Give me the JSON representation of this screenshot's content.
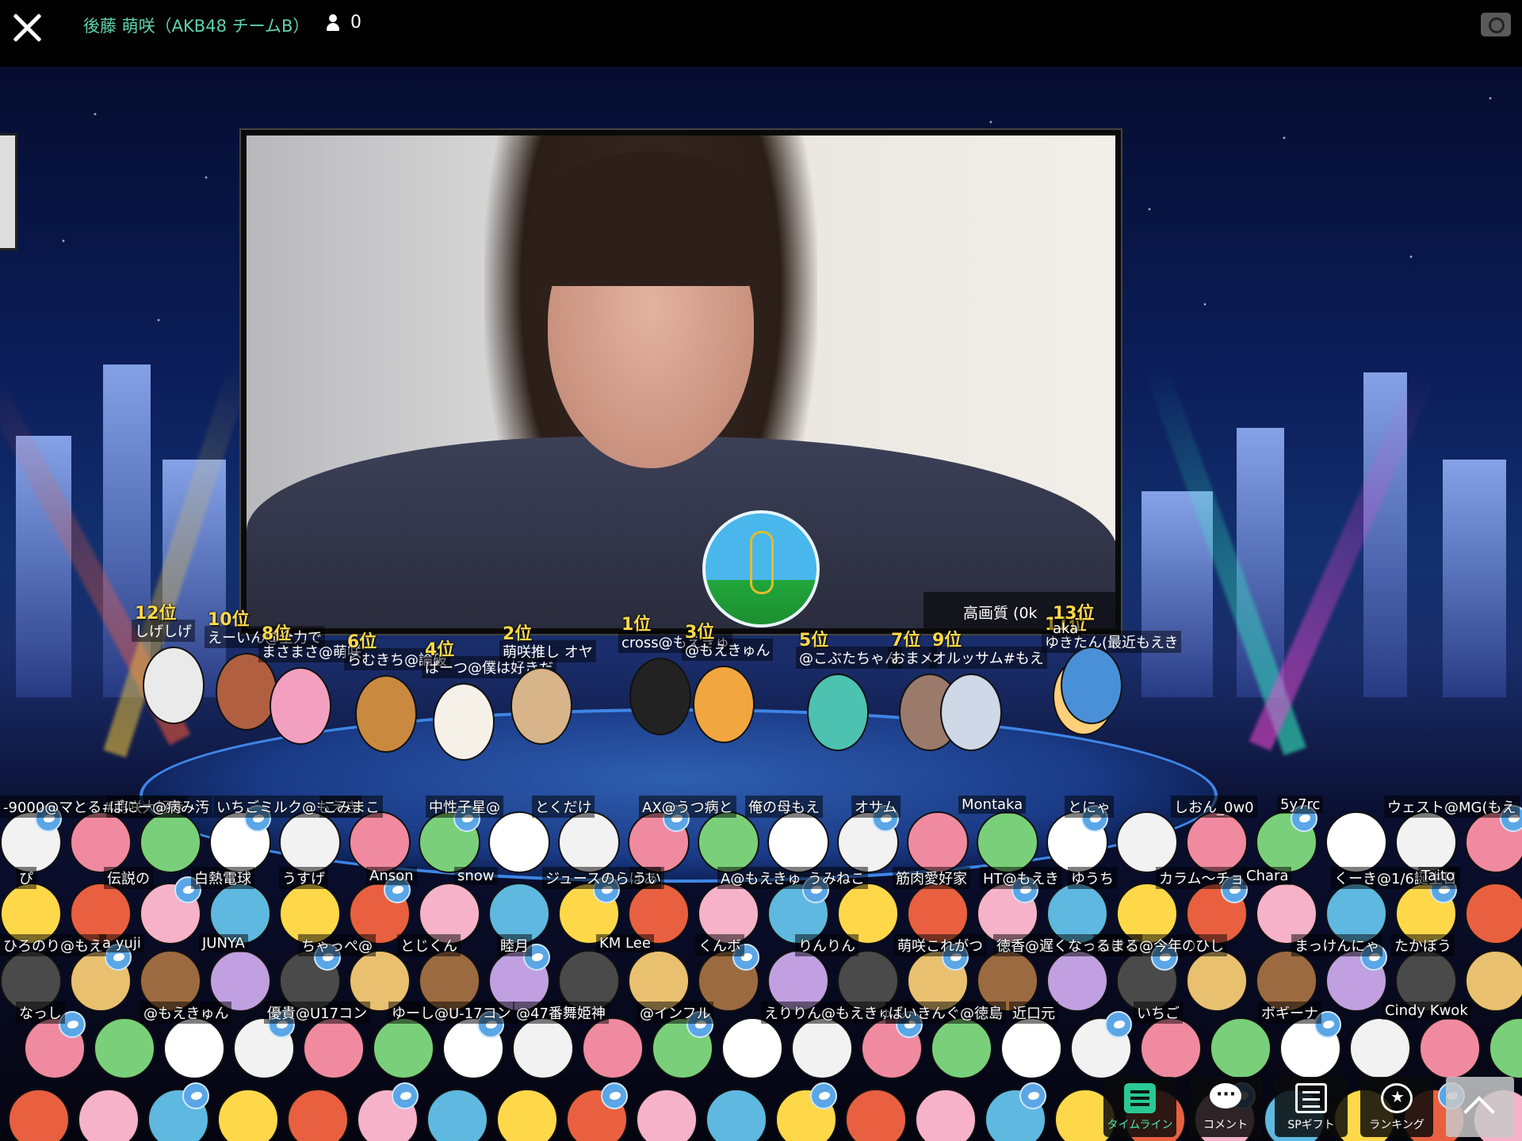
{
  "header": {
    "streamer_name": "後藤 萌咲（AKB48 チームB）",
    "viewer_count": "0"
  },
  "video": {
    "quality_label": "高画質 (0k"
  },
  "ranking": [
    {
      "rank": "12位",
      "name": "しげしげ"
    },
    {
      "rank": "10位",
      "name": "えーいん@全力で"
    },
    {
      "rank": "8位",
      "name": "まさまさ@萌咲"
    },
    {
      "rank": "6位",
      "name": "らむきち@論破"
    },
    {
      "rank": "4位",
      "name": "ぱーつ@僕は好きだ"
    },
    {
      "rank": "2位",
      "name": "萌咲推し オヤ"
    },
    {
      "rank": "1位",
      "name": "cross@もえきゅ"
    },
    {
      "rank": "3位",
      "name": "@もえきゅん"
    },
    {
      "rank": "5位",
      "name": "@こぶたちゃん"
    },
    {
      "rank": "7位",
      "name": "おまメ"
    },
    {
      "rank": "9位",
      "name": "オルッサム#もえ"
    },
    {
      "rank": "11位",
      "name": "ゆきたん(最近もえき"
    },
    {
      "rank": "13位",
      "name": "aka"
    }
  ],
  "fans": [
    "-9000@マとる#萌咲大好き",
    "ぱにー@病み汚",
    "いちごミルク@もえき",
    "こみまこ",
    "中性子星@",
    "とくだけ",
    "AX@うつ病と",
    "俺の母もえ",
    "オサム",
    "Montaka",
    "とにゃ",
    "しおん_0w0",
    "5y7rc",
    "ウェスト@MG(もえ",
    "ぴ",
    "伝説の",
    "白熱電球",
    "うすげ",
    "Anson",
    "snow",
    "ジュースのらばあ",
    "うい",
    "A@もえきゅ",
    "うみねこ",
    "筋肉愛好家",
    "HT@もえき",
    "ゆうち",
    "カラム〜チョ",
    "Chara",
    "くーき@1/6誕生日",
    "Taito",
    "ひろのり@もえ",
    "a yuji",
    "JUNYA",
    "ちゃっぺ@",
    "とじくん",
    "睦月",
    "KM Lee",
    "くんボ",
    "りんりん",
    "萌咲これがつ",
    "徳香@遅くなったけど",
    "るまる@今年の",
    "ひし",
    "まっけんにゃ",
    "たかぼう",
    "なっし",
    "@もえきゅん",
    "優貴@U17コン",
    "ゆーし@U-17コン",
    "@47番舞姫神",
    "@インフル",
    "えりりん@もえきゅん",
    "ばいきんぐ@徳島",
    "近口元",
    "いちご",
    "ボギーナ",
    "Cindy Kwok"
  ],
  "toolbar": {
    "timeline": "タイムライン",
    "comment": "コメント",
    "sp_gift": "SPギフト",
    "ranking": "ランキング"
  },
  "colors": {
    "streamer_name": "#5fd3b0",
    "rank_text": "#ffd84a",
    "active_tab": "#4ee6b0",
    "twitter": "#5aa6e6"
  },
  "icons": {
    "close": "close-icon",
    "viewer": "person-icon",
    "camera": "camera-switch-icon",
    "timeline": "timeline-icon",
    "comment": "comment-bubble-icon",
    "sp_gift": "gift-list-icon",
    "ranking": "ranking-medal-icon",
    "scroll_up": "chevron-up-icon"
  }
}
